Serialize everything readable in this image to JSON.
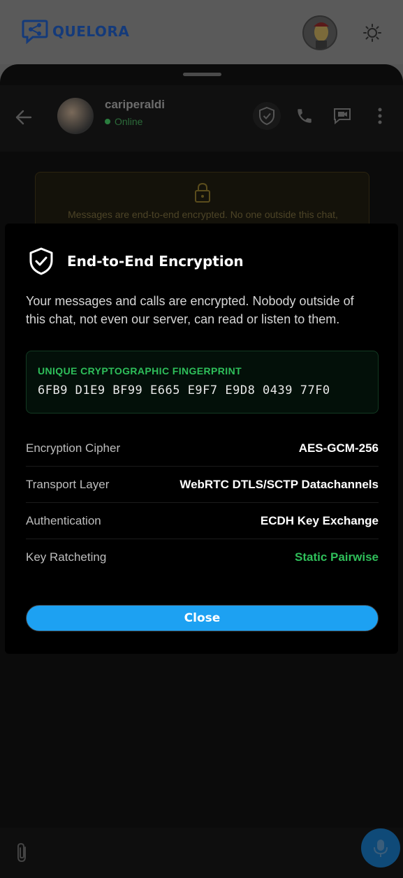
{
  "app": {
    "brand": "QUELORA"
  },
  "chat": {
    "peer_name": "cariperaldi",
    "peer_status": "Online",
    "banner_text": "Messages are end-to-end encrypted. No one outside this chat,"
  },
  "modal": {
    "title": "End-to-End Encryption",
    "description": "Your messages and calls are encrypted. Nobody outside of this chat, not even our server, can read or listen to them.",
    "fingerprint_label": "UNIQUE CRYPTOGRAPHIC FINGERPRINT",
    "fingerprint": "6FB9 D1E9 BF99 E665 E9F7 E9D8 0439 77F0",
    "rows": [
      {
        "label": "Encryption Cipher",
        "value": "AES-GCM-256"
      },
      {
        "label": "Transport Layer",
        "value": "WebRTC DTLS/SCTP Datachannels"
      },
      {
        "label": "Authentication",
        "value": "ECDH Key Exchange"
      },
      {
        "label": "Key Ratcheting",
        "value": "Static Pairwise"
      }
    ],
    "close_label": "Close"
  },
  "icons": {
    "brand": "chat-share-logo-icon",
    "theme": "sun-icon",
    "back": "arrow-left-icon",
    "verify": "shield-check-icon",
    "call": "phone-icon",
    "video": "video-chat-icon",
    "more": "more-vertical-icon",
    "lock": "lock-icon",
    "attach": "paperclip-icon",
    "mic": "microphone-icon"
  },
  "colors": {
    "accent": "#1da1f2",
    "success": "#2fbf5a",
    "brand": "#143a7a"
  }
}
